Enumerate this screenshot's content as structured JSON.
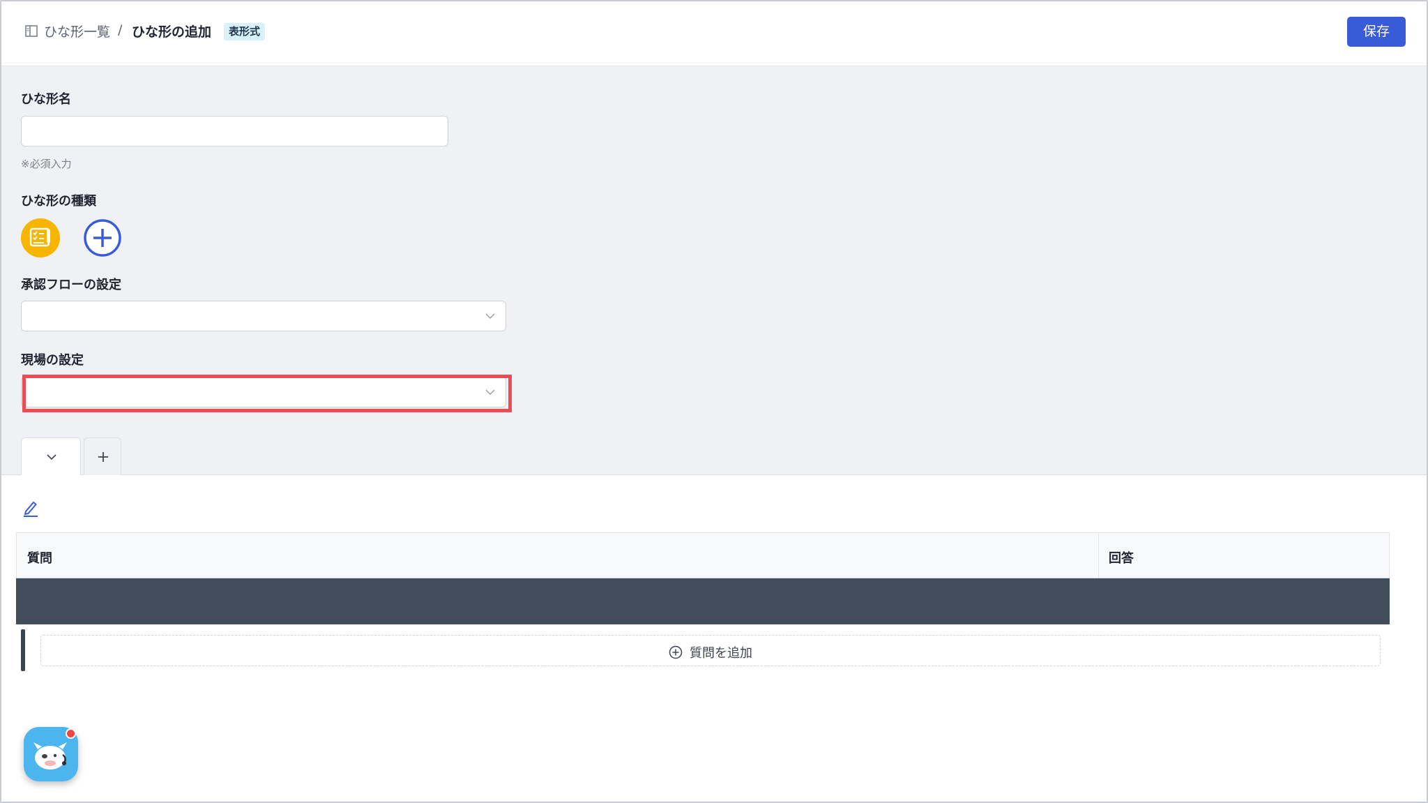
{
  "header": {
    "breadcrumb_link": "ひな形一覧",
    "breadcrumb_separator": "/",
    "breadcrumb_current": "ひな形の追加",
    "badge": "表形式",
    "save_label": "保存"
  },
  "form": {
    "template_name_label": "ひな形名",
    "template_name_value": "",
    "required_hint": "※必須入力",
    "template_type_label": "ひな形の種類",
    "approval_flow_label": "承認フローの設定",
    "approval_flow_value": "",
    "site_label": "現場の設定",
    "site_value": ""
  },
  "tabs": {
    "add_tab_symbol": "+"
  },
  "table": {
    "column_question": "質問",
    "column_answer": "回答",
    "add_question_label": "質問を追加"
  },
  "colors": {
    "primary": "#3a5bd8",
    "highlight": "#ee4c55",
    "type_icon": "#f7b500",
    "dark_row": "#414d5a"
  },
  "icons": [
    "sidebar-icon",
    "checklist-icon",
    "add-circle-icon",
    "chevron-down-icon",
    "plus-icon",
    "pencil-icon",
    "add-circle-icon",
    "chat-assistant-icon"
  ]
}
